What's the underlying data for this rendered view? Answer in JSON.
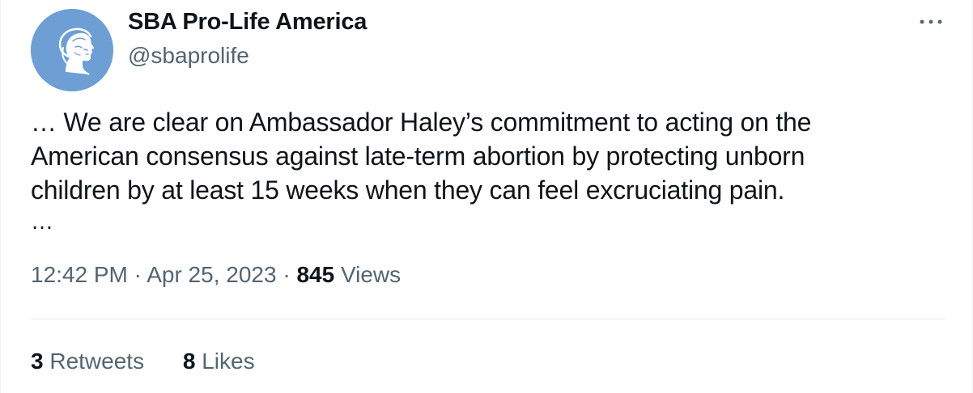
{
  "colors": {
    "text_primary": "#0f1419",
    "text_secondary": "#536471",
    "avatar_background": "#6e9fd4",
    "divider": "#e6ecf0"
  },
  "author": {
    "display_name": "SBA Pro-Life America",
    "handle": "@sbaprolife",
    "avatar_icon": "woman-profile-logo-icon"
  },
  "more_menu_icon": "more-horizontal-icon",
  "tweet": {
    "lines": [
      "… We are clear on Ambassador Haley’s commitment to acting on the",
      "American consensus against late-term abortion by protecting unborn",
      "children by at least 15 weeks when they can feel excruciating pain."
    ],
    "trailing": "…"
  },
  "meta": {
    "time": "12:42 PM",
    "separator": "·",
    "date": "Apr 25, 2023",
    "views_count": "845",
    "views_label": "Views"
  },
  "stats": {
    "retweets_count": "3",
    "retweets_label": "Retweets",
    "likes_count": "8",
    "likes_label": "Likes"
  }
}
